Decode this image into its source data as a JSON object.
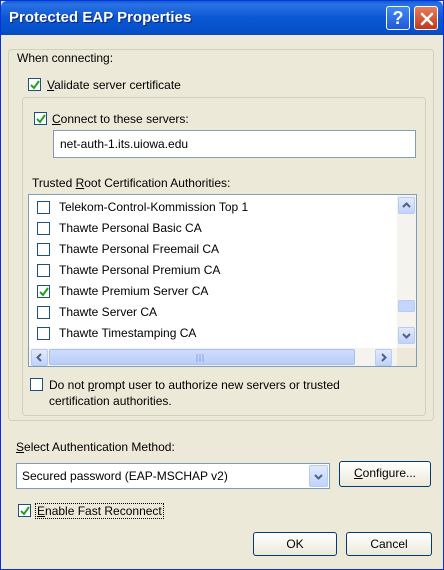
{
  "window": {
    "title": "Protected EAP Properties",
    "help_glyph": "?"
  },
  "connecting": {
    "label": "When connecting:",
    "validate_cert": {
      "pre": "",
      "key": "V",
      "post": "alidate server certificate",
      "checked": true
    },
    "connect_servers": {
      "pre": "",
      "key": "C",
      "post": "onnect to these servers:",
      "checked": true
    },
    "servers_value": "net-auth-1.its.uiowa.edu",
    "trusted_label": {
      "pre": "Trusted ",
      "key": "R",
      "post": "oot Certification Authorities:"
    },
    "ca_list": [
      {
        "label": "Telekom-Control-Kommission Top 1",
        "checked": false
      },
      {
        "label": "Thawte Personal Basic CA",
        "checked": false
      },
      {
        "label": "Thawte Personal Freemail CA",
        "checked": false
      },
      {
        "label": "Thawte Personal Premium CA",
        "checked": false
      },
      {
        "label": "Thawte Premium Server CA",
        "checked": true
      },
      {
        "label": "Thawte Server CA",
        "checked": false
      },
      {
        "label": "Thawte Timestamping CA",
        "checked": false
      }
    ],
    "no_prompt": {
      "line1_pre": "Do not ",
      "line1_key": "p",
      "line1_post": "rompt user to authorize new servers or trusted",
      "line2": "certification authorities.",
      "checked": false
    }
  },
  "auth": {
    "label": {
      "pre": "",
      "key": "S",
      "post": "elect Authentication Method:"
    },
    "method_value": "Secured password (EAP-MSCHAP v2)",
    "configure_label": {
      "pre": "",
      "key": "C",
      "post": "onfigure..."
    }
  },
  "fast_reconnect": {
    "pre": "",
    "key": "E",
    "post": "nable Fast Reconnect",
    "checked": true
  },
  "buttons": {
    "ok": "OK",
    "cancel": "Cancel"
  }
}
